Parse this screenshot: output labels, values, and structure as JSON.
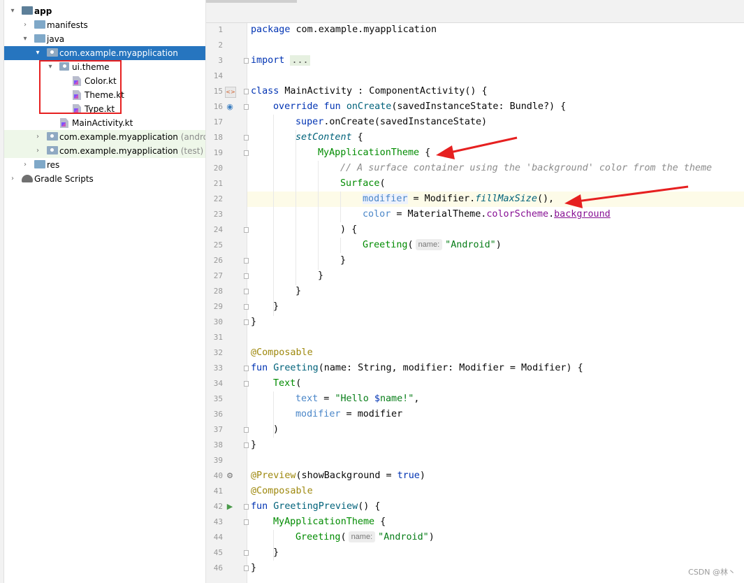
{
  "project_tree": {
    "items": [
      {
        "label": "app",
        "suffix": "",
        "bold": true
      },
      {
        "label": "manifests",
        "suffix": ""
      },
      {
        "label": "java",
        "suffix": ""
      },
      {
        "label": "com.example.myapplication",
        "suffix": "",
        "selected": true
      },
      {
        "label": "ui.theme",
        "suffix": ""
      },
      {
        "label": "Color.kt",
        "suffix": ""
      },
      {
        "label": "Theme.kt",
        "suffix": ""
      },
      {
        "label": "Type.kt",
        "suffix": ""
      },
      {
        "label": "MainActivity.kt",
        "suffix": ""
      },
      {
        "label": "com.example.myapplication",
        "suffix": " (androidTe"
      },
      {
        "label": "com.example.myapplication",
        "suffix": " (test)"
      },
      {
        "label": "res",
        "suffix": ""
      },
      {
        "label": "Gradle Scripts",
        "suffix": ""
      }
    ]
  },
  "editor": {
    "line_numbers": [
      "1",
      "2",
      "3",
      "14",
      "15",
      "16",
      "17",
      "18",
      "19",
      "20",
      "21",
      "22",
      "23",
      "24",
      "25",
      "26",
      "27",
      "28",
      "29",
      "30",
      "31",
      "32",
      "33",
      "34",
      "35",
      "36",
      "37",
      "38",
      "39",
      "40",
      "41",
      "42",
      "43",
      "44",
      "45",
      "46"
    ],
    "code": {
      "l1_kw": "package",
      "l1_rest": " com.example.myapplication",
      "l3_kw": "import",
      "l3_dots": "...",
      "l15_kw": "class",
      "l15_rest": " MainActivity : ComponentActivity() {",
      "l16_kw": "override fun",
      "l16_fn": "onCreate",
      "l16_rest": "(savedInstanceState: Bundle?) {",
      "l17_kw": "super",
      "l17_rest": ".onCreate(savedInstanceState)",
      "l18_fn": "setContent",
      "l18_rest": " {",
      "l19_cmp": "MyApplicationTheme",
      "l19_rest": " {",
      "l20_cmt": "// A surface container using the 'background' color from the theme",
      "l21_cmp": "Surface",
      "l21_rest": "(",
      "l22_prm": "modifier",
      "l22_eq": " = Modifier.",
      "l22_fn": "fillMaxSize",
      "l22_rest": "(),",
      "l23_prm": "color",
      "l23_eq": " = MaterialTheme.",
      "l23_prop": "colorScheme",
      "l23_dot": ".",
      "l23_prop2": "background",
      "l24": ") {",
      "l25_cmp": "Greeting",
      "l25_paren": "(",
      "l25_hint": "name:",
      "l25_str": "\"Android\"",
      "l25_rest": ")",
      "l26": "}",
      "l27": "}",
      "l28": "}",
      "l29": "}",
      "l30": "}",
      "l32_ann": "@Composable",
      "l33_kw": "fun",
      "l33_fn": "Greeting",
      "l33_rest": "(name: String, modifier: Modifier = Modifier) {",
      "l34_cmp": "Text",
      "l34_rest": "(",
      "l35_prm": "text",
      "l35_eq": " = ",
      "l35_str1": "\"Hello ",
      "l35_var": "$",
      "l35_str2": "name!\"",
      "l35_rest": ",",
      "l36_prm": "modifier",
      "l36_eq": " = ",
      "l36_rest": "modifier",
      "l37": ")",
      "l38": "}",
      "l40_ann": "@Preview",
      "l40_rest": "(showBackground = ",
      "l40_kw": "true",
      "l40_end": ")",
      "l41_ann": "@Composable",
      "l42_kw": "fun",
      "l42_fn": "GreetingPreview",
      "l42_rest": "() {",
      "l43_cmp": "MyApplicationTheme",
      "l43_rest": " {",
      "l44_cmp": "Greeting",
      "l44_paren": "(",
      "l44_hint": "name:",
      "l44_str": "\"Android\"",
      "l44_rest": ")",
      "l45": "}",
      "l46": "}"
    }
  },
  "watermark": "CSDN @林丶",
  "colors": {
    "selection": "#2675bf",
    "annotation_red": "#e62020",
    "current_line": "#fdfbe8"
  }
}
